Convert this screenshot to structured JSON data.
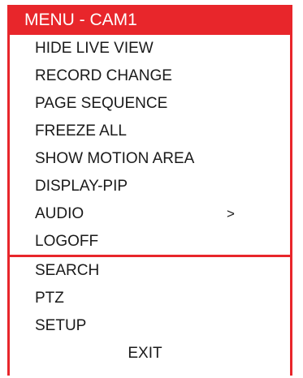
{
  "menu": {
    "title": "MENU - CAM1",
    "main_items": [
      {
        "label": "HIDE LIVE VIEW"
      },
      {
        "label": "RECORD CHANGE"
      },
      {
        "label": "PAGE SEQUENCE"
      },
      {
        "label": "FREEZE ALL"
      },
      {
        "label": "SHOW MOTION AREA"
      },
      {
        "label": "DISPLAY-PIP"
      },
      {
        "label": "AUDIO",
        "submenu_indicator": ">"
      },
      {
        "label": "LOGOFF"
      }
    ],
    "lower_items": [
      {
        "label": "SEARCH"
      },
      {
        "label": "PTZ"
      },
      {
        "label": "SETUP"
      },
      {
        "label": "EXIT"
      }
    ]
  },
  "colors": {
    "accent": "#e8262b",
    "text": "#1a1a1a",
    "header_text": "#ffffff",
    "background": "#ffffff"
  }
}
